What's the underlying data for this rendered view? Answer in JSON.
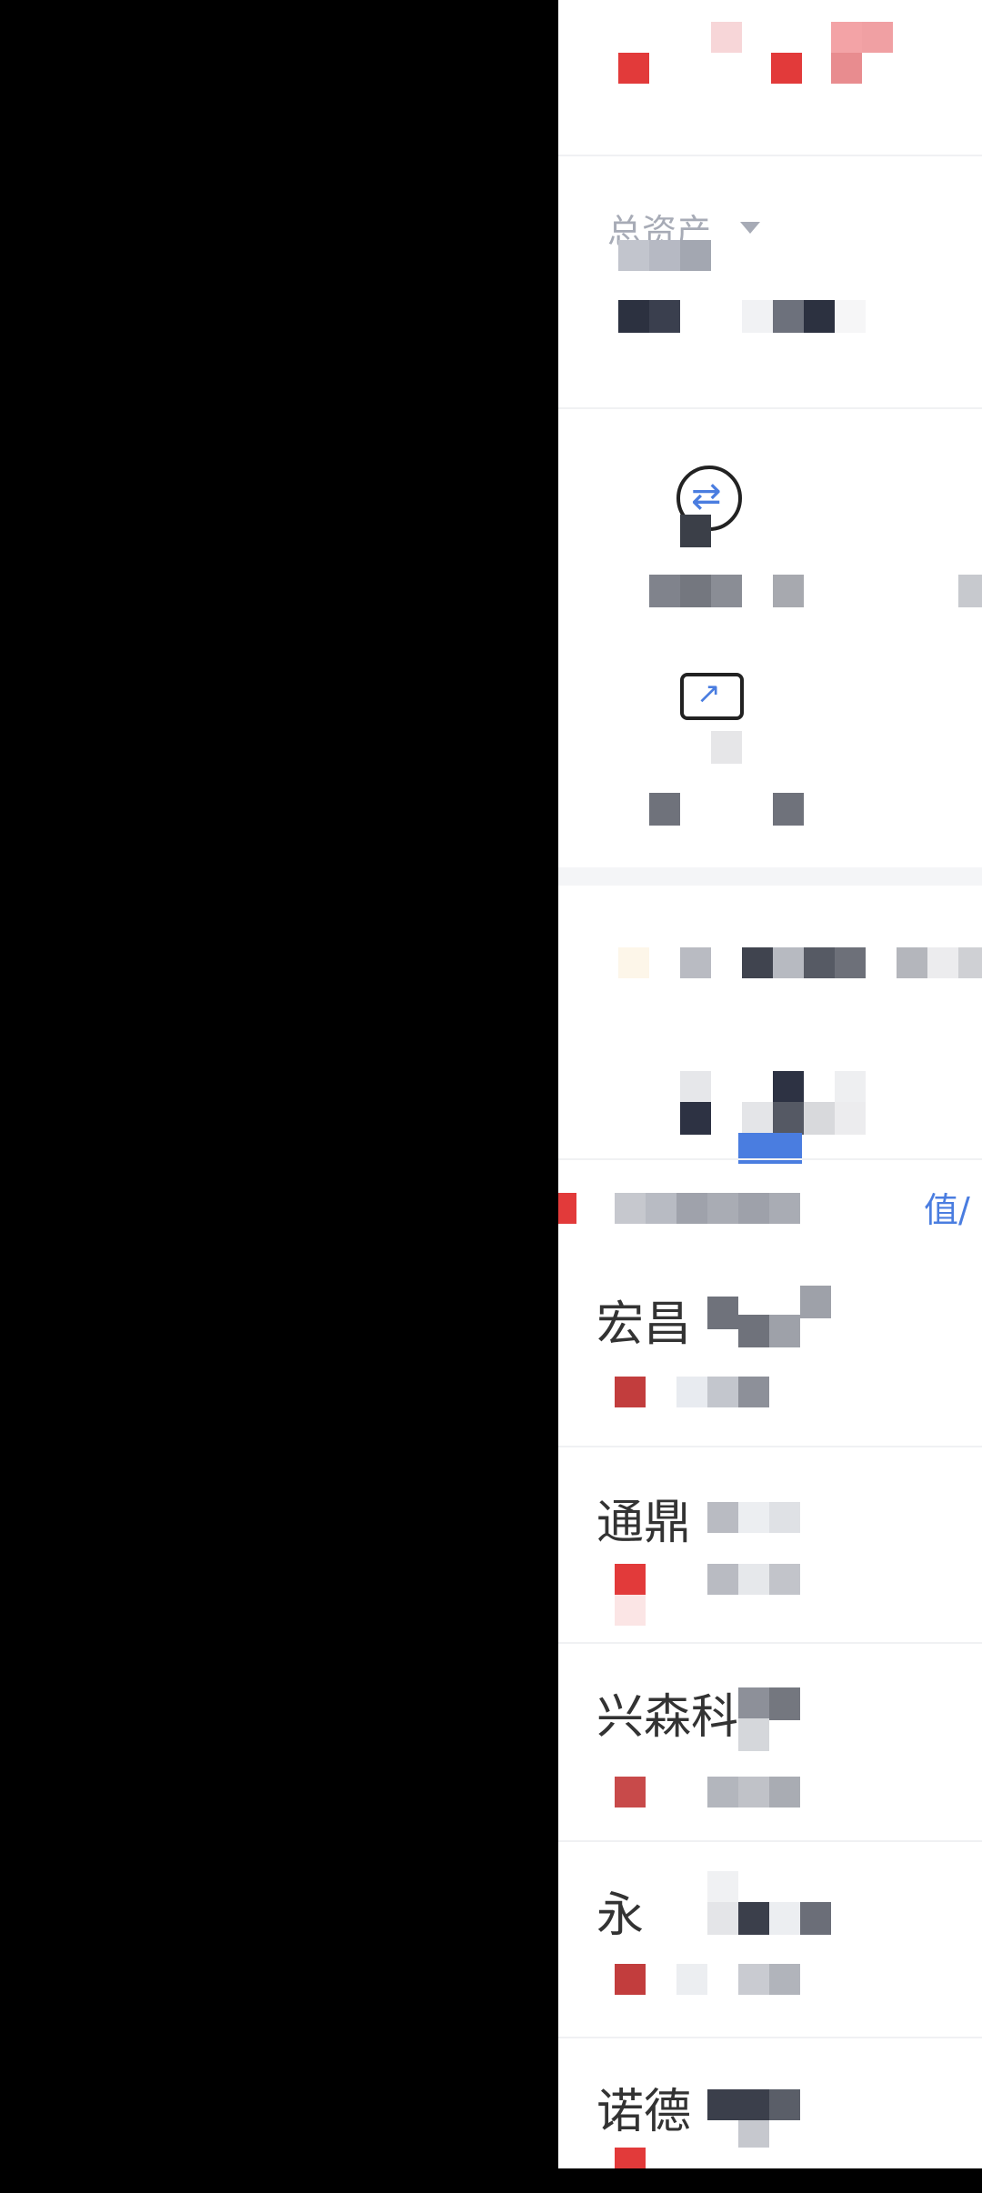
{
  "account": {
    "total_assets_label": "总资产",
    "dropdown_icon": "caret-down-icon"
  },
  "quick_actions": [
    {
      "icon": "transfer-icon",
      "glyph": "⇄"
    },
    {
      "icon": "trend-chart-icon",
      "glyph": "↗"
    }
  ],
  "holdings_header": {
    "column_label": "值/"
  },
  "holdings": [
    {
      "name": "宏昌"
    },
    {
      "name": "通鼎"
    },
    {
      "name": "兴森科"
    },
    {
      "name": "永"
    },
    {
      "name": "诺德"
    }
  ],
  "colors": {
    "accent_red": "#e23a3a",
    "link_blue": "#4a7de0",
    "mosaic_dark": "#2c3140"
  }
}
